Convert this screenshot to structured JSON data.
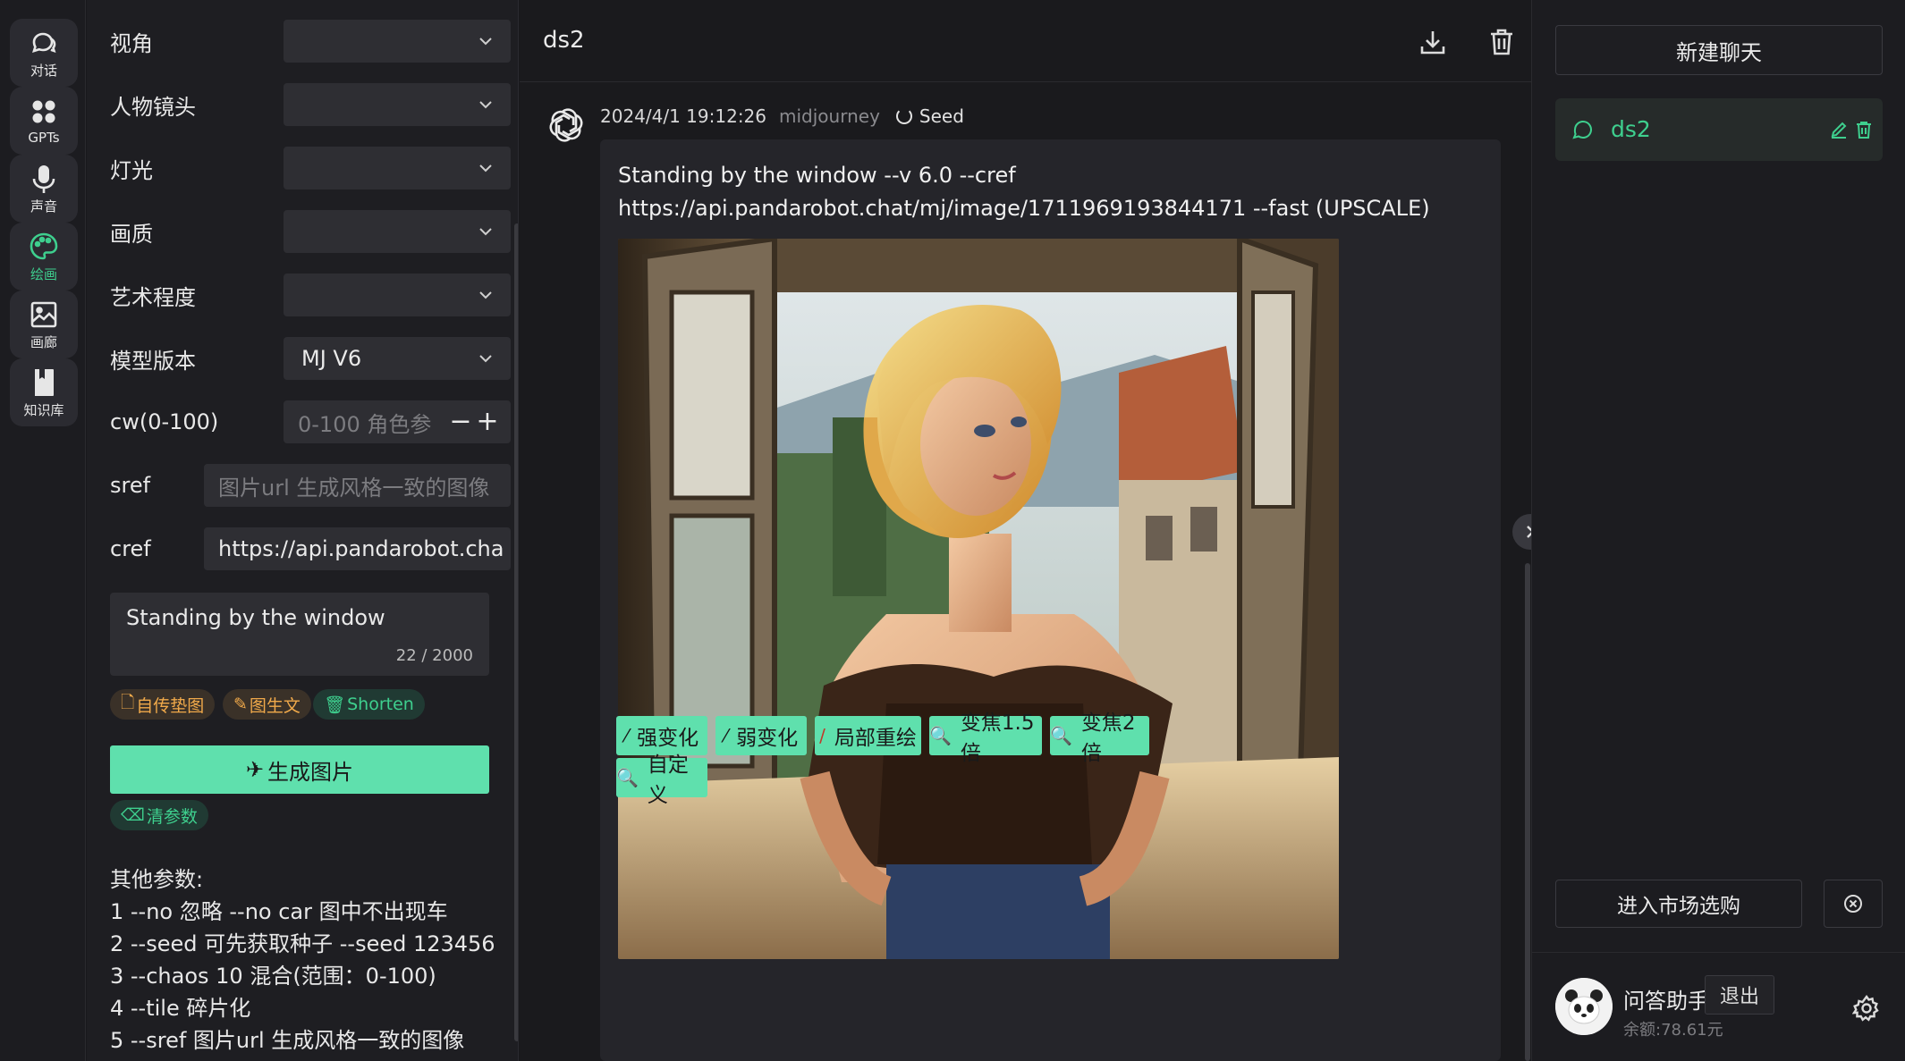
{
  "nav": {
    "items": [
      {
        "label": "对话",
        "icon": "chat-icon"
      },
      {
        "label": "GPTs",
        "icon": "apps-grid-icon"
      },
      {
        "label": "声音",
        "icon": "microphone-icon"
      },
      {
        "label": "绘画",
        "icon": "palette-icon",
        "active": true
      },
      {
        "label": "画廊",
        "icon": "image-icon"
      },
      {
        "label": "知识库",
        "icon": "book-icon"
      }
    ]
  },
  "params": {
    "fields": [
      {
        "label": "视角",
        "value": ""
      },
      {
        "label": "人物镜头",
        "value": ""
      },
      {
        "label": "灯光",
        "value": ""
      },
      {
        "label": "画质",
        "value": ""
      },
      {
        "label": "艺术程度",
        "value": ""
      },
      {
        "label": "模型版本",
        "value": "MJ V6"
      }
    ],
    "cw": {
      "label": "cw(0-100)",
      "placeholder": "0-100 角色参",
      "minus": "−",
      "plus": "+"
    },
    "sref": {
      "label": "sref",
      "placeholder": "图片url 生成风格一致的图像"
    },
    "cref": {
      "label": "cref",
      "value": "https://api.pandarobot.cha"
    },
    "prompt": {
      "text": "Standing by the window",
      "count": "22 / 2000"
    },
    "tags": {
      "upload": "自传垫图",
      "img2txt": "图生文",
      "shorten": "Shorten"
    },
    "generate": "生成图片",
    "clear": "清参数",
    "other": {
      "title": "其他参数:",
      "lines": [
        "1 --no 忽略 --no car 图中不出现车",
        "2 --seed 可先获取种子 --seed 123456",
        "3 --chaos 10 混合(范围：0-100)",
        "4 --tile 碎片化",
        "5 --sref 图片url 生成风格一致的图像"
      ]
    }
  },
  "chat": {
    "title": "ds2",
    "message": {
      "date": "2024/4/1 19:12:26",
      "model": "midjourney",
      "seed_label": "Seed",
      "prompt_line1": "Standing by the window --v 6.0 --cref",
      "prompt_line2": "https://api.pandarobot.chat/mj/image/1711969193844171 --fast (UPSCALE)",
      "actions": [
        "强变化",
        "弱变化",
        "局部重绘",
        "变焦1.5倍",
        "变焦2倍",
        "自定义"
      ]
    }
  },
  "sidebar": {
    "new_chat": "新建聊天",
    "conversations": [
      {
        "label": "ds2"
      }
    ],
    "market": "进入市场选购",
    "user": {
      "name": "问答助手",
      "logout": "退出",
      "balance": "余额:78.61元"
    }
  },
  "colors": {
    "accent": "#5fe0ad",
    "accent_text": "#3ecf8e",
    "tag_orange": "#f0a94a"
  }
}
